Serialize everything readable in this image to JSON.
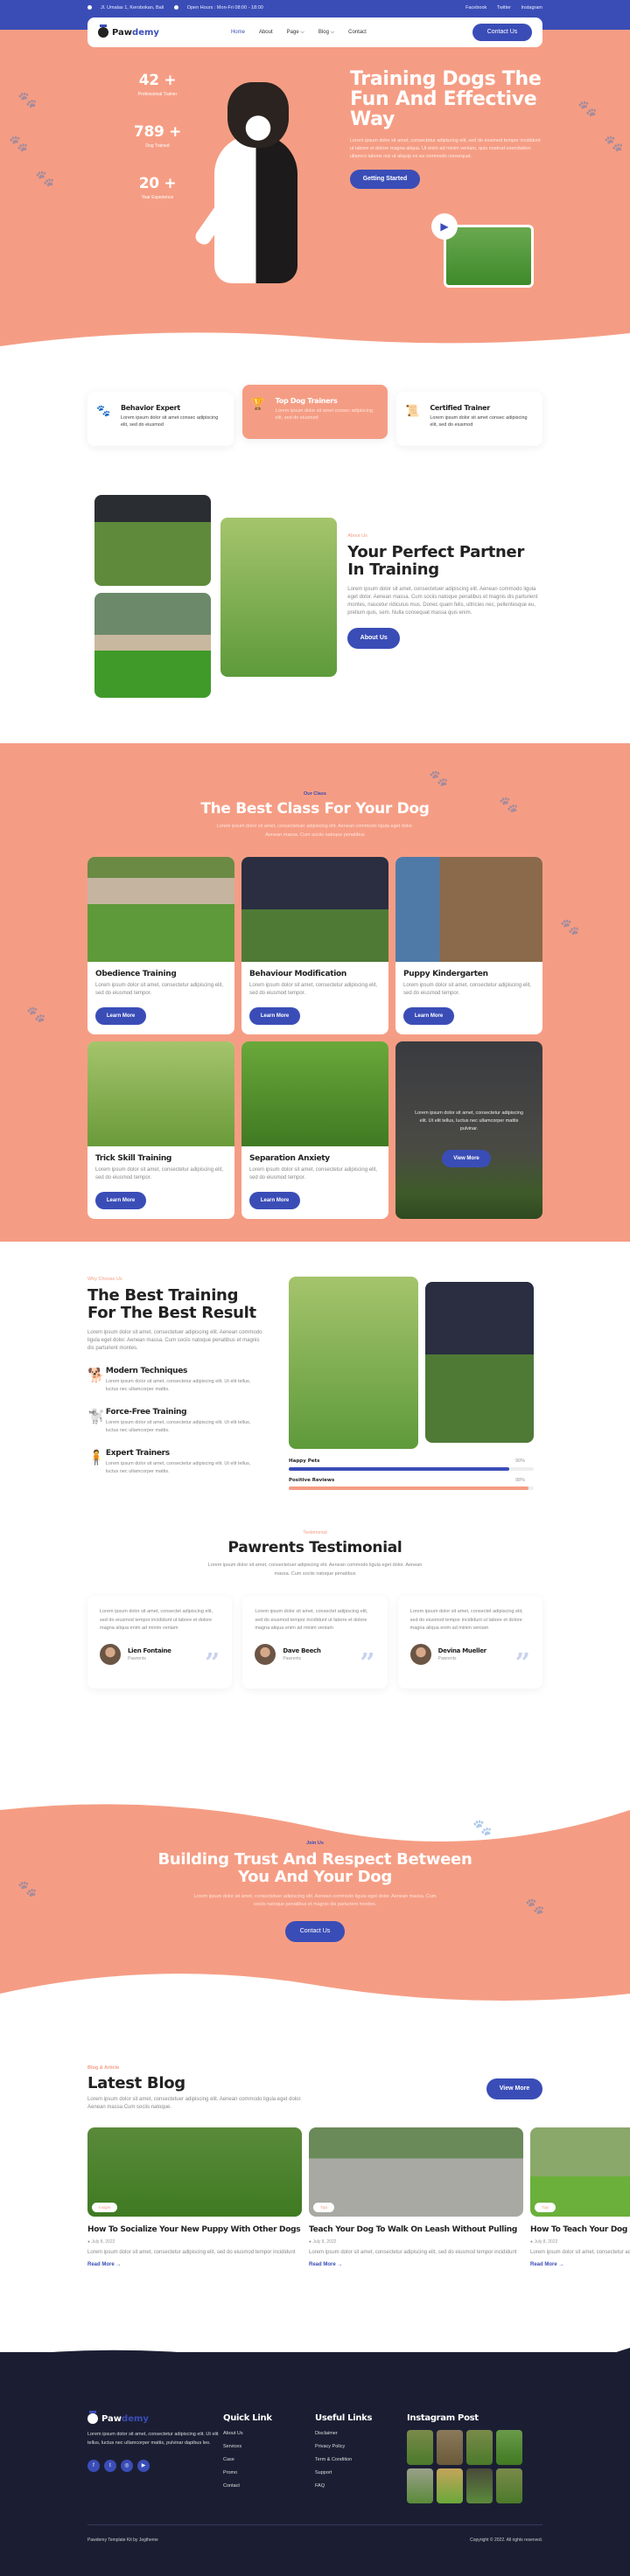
{
  "topbar": {
    "address": "Jl. Umalas 1, Kerobokan, Bali",
    "hours": "Open Hours : Mon-Fri 08:00 - 18:00",
    "social": [
      "Facebook",
      "Twitter",
      "Instagram"
    ]
  },
  "nav": {
    "logo_part1": "Paw",
    "logo_part2": "demy",
    "items": [
      "Home",
      "About",
      "Page",
      "Blog",
      "Contact"
    ],
    "cta": "Contact Us"
  },
  "hero": {
    "stats": [
      {
        "value": "42 +",
        "label": "Professional Trainer"
      },
      {
        "value": "789 +",
        "label": "Dog Trained"
      },
      {
        "value": "20 +",
        "label": "Year Experience"
      }
    ],
    "title": "Training Dogs The Fun And Effective Way",
    "text": "Lorem ipsum dolor sit amet, consectetur adipiscing elit, sed do eiusmod tempor incididunt ut labore et dolore magna aliqua. Ut enim ad minim veniam, quis nostrud exercitation ullamco laboris nisi ut aliquip ex ea commodo consequat.",
    "button": "Getting Started"
  },
  "features": [
    {
      "icon": "paw-icon",
      "title": "Behavior Expert",
      "text": "Lorem ipsum dolor sit amet consec adipiscing elit, sed do eiusmod"
    },
    {
      "icon": "trophy-icon",
      "title": "Top Dog Trainers",
      "text": "Lorem ipsum dolor sit amet consec adipiscing elit, sed do eiusmod"
    },
    {
      "icon": "certificate-icon",
      "title": "Certified Trainer",
      "text": "Lorem ipsum dolor sit amet consec adipiscing elit, sed do eiusmod"
    }
  ],
  "about": {
    "tag": "About Us",
    "title": "Your Perfect Partner In Training",
    "text": "Lorem ipsum dolor sit amet, consectetuer adipiscing elit. Aenean commodo ligula eget dolor. Aenean massa. Cum sociis natoque penatibus et magnis dis parturient montes, nascetur ridiculus mus. Donec quam felis, ultricies nec, pellentesque eu, pretium quis, sem. Nulla consequat massa quis enim.",
    "button": "About Us"
  },
  "classes": {
    "tag": "Our Class",
    "title": "The Best Class For Your Dog",
    "text": "Lorem ipsum dolor sit amet, consectetuer adipiscing elit. Aenean commodo ligula eget dolor. Aenean massa. Cum sociis natoque penatibus",
    "items": [
      {
        "title": "Obedience Training",
        "text": "Lorem ipsum dolor sit amet, consectetur adipiscing elit, sed do eiusmod tempor.",
        "button": "Learn More"
      },
      {
        "title": "Behaviour Modification",
        "text": "Lorem ipsum dolor sit amet, consectetur adipiscing elit, sed do eiusmod tempor.",
        "button": "Learn More"
      },
      {
        "title": "Puppy Kindergarten",
        "text": "Lorem ipsum dolor sit amet, consectetur adipiscing elit, sed do eiusmod tempor.",
        "button": "Learn More"
      },
      {
        "title": "Trick Skill Training",
        "text": "Lorem ipsum dolor sit amet, consectetur adipiscing elit, sed do eiusmod tempor.",
        "button": "Learn More"
      },
      {
        "title": "Separation Anxiety",
        "text": "Lorem ipsum dolor sit amet, consectetur adipiscing elit, sed do eiusmod tempor.",
        "button": "Learn More"
      }
    ],
    "overlay": {
      "text": "Lorem ipsum dolor sit amet, consectetur adipiscing elit. Ut elit tellus, luctus nec ullamcorper mattis pulvinar.",
      "button": "View More"
    }
  },
  "why": {
    "tag": "Why Choose Us",
    "title": "The Best Training For The Best Result",
    "text": "Lorem ipsum dolor sit amet, consectetuer adipiscing elit. Aenean commodo ligula eget dolor. Aenean massa. Cum sociis natoque penatibus et magnis dis parturient montes.",
    "items": [
      {
        "icon": "dog-icon",
        "title": "Modern Techniques",
        "text": "Lorem ipsum dolor sit amet, consectetur adipiscing elit. Ut elit tellus, luctus nec ullamcorper mattis."
      },
      {
        "icon": "jumping-dog-icon",
        "title": "Force-Free Training",
        "text": "Lorem ipsum dolor sit amet, consectetur adipiscing elit. Ut elit tellus, luctus nec ullamcorper mattis."
      },
      {
        "icon": "trainer-icon",
        "title": "Expert Trainers",
        "text": "Lorem ipsum dolor sit amet, consectetur adipiscing elit. Ut elit tellus, luctus nec ullamcorper mattis."
      }
    ],
    "bars": [
      {
        "label": "Happy Pets",
        "value": "90%",
        "percent": 90,
        "color": "#3a4db7"
      },
      {
        "label": "Positive Reviews",
        "value": "98%",
        "percent": 98,
        "color": "#f59d84"
      }
    ]
  },
  "testimonial": {
    "tag": "Testimonial",
    "title": "Pawrents Testimonial",
    "text": "Lorem ipsum dolor sit amet, consectetuer adipiscing elit. Aenean commodo ligula eget dolor. Aenean massa. Cum sociis natoque penatibus",
    "items": [
      {
        "quote": "Lorem ipsum dolor sit amet, consectet adipiscing elit, sed do eiusmod tempor incididunt ut labore et dolore magna aliqua enim ad minim veniam",
        "name": "Lien Fontaine",
        "role": "Pawrents"
      },
      {
        "quote": "Lorem ipsum dolor sit amet, consectet adipiscing elit, sed do eiusmod tempor incididunt ut labore et dolore magna aliqua enim ad minim veniam",
        "name": "Dave Beech",
        "role": "Pawrents"
      },
      {
        "quote": "Lorem ipsum dolor sit amet, consectet adipiscing elit, sed do eiusmod tempor incididunt ut labore et dolore magna aliqua enim ad minim veniam",
        "name": "Devina Mueller",
        "role": "Pawrents"
      }
    ]
  },
  "join": {
    "tag": "Join Us",
    "title": "Building Trust And Respect Between You And Your Dog",
    "text": "Lorem ipsum dolor sit amet, consectetuer adipiscing elit. Aenean commodo ligula eget dolor. Aenean massa. Cum sociis natoque penatibus et magnis dis parturient montes.",
    "button": "Contact Us"
  },
  "blog": {
    "tag": "Blog & Article",
    "title": "Latest Blog",
    "text": "Lorem ipsum dolor sit amet, consectetuer adipiscing elit. Aenean commodo ligula eget dolor. Aenean massa Cum sociis natoque.",
    "button": "View More",
    "posts": [
      {
        "chip": "Insight",
        "title": "How To Socialize Your New Puppy With Other Dogs",
        "date": "July 8, 2022",
        "text": "Lorem ipsum dolor sit amet, consectetur adipiscing elit, sed do eiusmod tempor incididunt",
        "link": "Read More →"
      },
      {
        "chip": "Tips",
        "title": "Teach Your Dog To Walk On Leash Without Pulling",
        "date": "July 8, 2022",
        "text": "Lorem ipsum dolor sit amet, consectetur adipiscing elit, sed do eiusmod tempor incididunt",
        "link": "Read More →"
      },
      {
        "chip": "Tips",
        "title": "How To Teach Your Dog To Drop Items",
        "date": "July 8, 2022",
        "text": "Lorem ipsum dolor sit amet, consectetur adipiscing elit, sed do eiusmod tempor incididunt",
        "link": "Read More →"
      }
    ]
  },
  "footer": {
    "about": "Lorem ipsum dolor sit amet, consectetur adipiscing elit. Ut elit tellus, luctus nec ullamcorper mattis, pulvinar dapibus leo.",
    "social_icons": [
      "facebook-icon",
      "twitter-icon",
      "instagram-icon",
      "youtube-icon"
    ],
    "quick_title": "Quick Link",
    "quick": [
      "About Us",
      "Services",
      "Case",
      "Promo",
      "Contact"
    ],
    "useful_title": "Useful Links",
    "useful": [
      "Disclaimer",
      "Privacy Policy",
      "Term & Condition",
      "Support",
      "FAQ"
    ],
    "insta_title": "Instagram Post",
    "credit": "Pawdemy Template Kit by Jegtheme",
    "copyright": "Copyright © 2022. All rights reserved."
  },
  "colors": {
    "primary": "#3a4db7",
    "accent": "#f59d84",
    "footer": "#1b1e33"
  }
}
